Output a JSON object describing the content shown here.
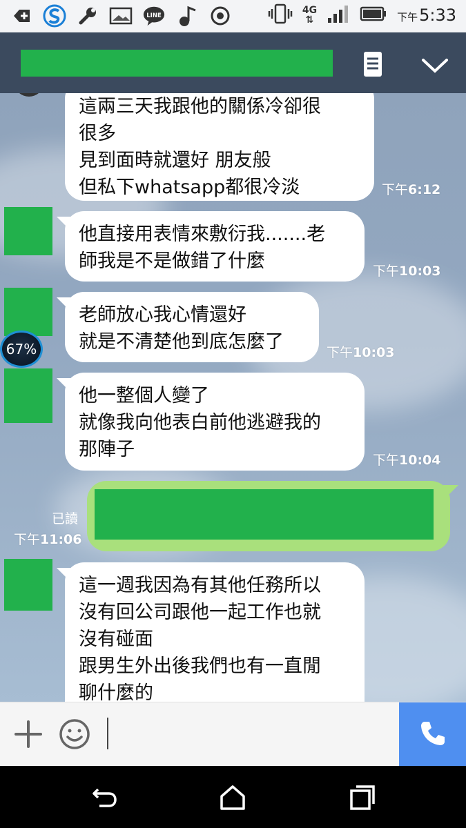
{
  "statusbar": {
    "network": "4G",
    "time_prefix": "下午",
    "time": "5:33"
  },
  "header": {
    "title_redacted": true
  },
  "battery_overlay": "67%",
  "messages": [
    {
      "side": "left",
      "text": "這兩三天我跟他的關係冷卻很\n很多\n見到面時就還好 朋友般\n但私下whatsapp都很冷淡",
      "time_prefix": "下午",
      "time": "6:12"
    },
    {
      "side": "left",
      "text": "他直接用表情來敷衍我.......老\n師我是不是做錯了什麼",
      "time_prefix": "下午",
      "time": "10:03"
    },
    {
      "side": "left",
      "text": "老師放心我心情還好\n就是不清楚他到底怎麼了",
      "time_prefix": "下午",
      "time": "10:03"
    },
    {
      "side": "left",
      "text": "他一整個人變了\n就像我向他表白前他逃避我的\n那陣子",
      "time_prefix": "下午",
      "time": "10:04"
    },
    {
      "side": "right",
      "read_label": "已讀",
      "time_prefix": "下午",
      "time": "11:06"
    },
    {
      "side": "left",
      "text": "這一週我因為有其他任務所以\n沒有回公司跟他一起工作也就\n沒有碰面\n跟男生外出後我們也有一直閒\n聊什麼的"
    }
  ],
  "colors": {
    "header_bg": "#3b4a5e",
    "redaction": "#22b14c",
    "my_bubble": "#a9e07c",
    "call_button": "#4f8ff0"
  }
}
